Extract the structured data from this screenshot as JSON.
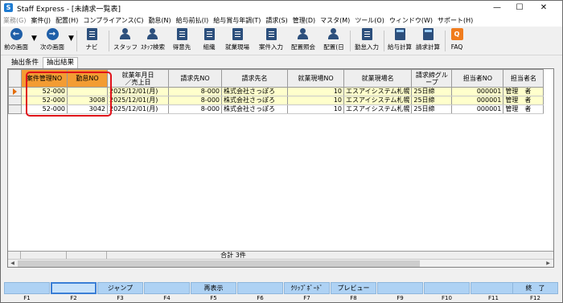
{
  "window": {
    "title": "Staff Express - [未請求一覧表]",
    "app_icon": "S",
    "minimize": "—",
    "maximize": "☐",
    "close": "✕"
  },
  "menu": [
    {
      "label": "業務(G)",
      "disabled": true
    },
    {
      "label": "案件(J)"
    },
    {
      "label": "配置(H)"
    },
    {
      "label": "コンプライアンス(C)"
    },
    {
      "label": "勤怠(N)"
    },
    {
      "label": "給与前払(I)"
    },
    {
      "label": "給与賞与年調(T)"
    },
    {
      "label": "請求(S)"
    },
    {
      "label": "管理(D)"
    },
    {
      "label": "マスタ(M)"
    },
    {
      "label": "ツール(O)"
    },
    {
      "label": "ウィンドウ(W)"
    },
    {
      "label": "サポート(H)"
    }
  ],
  "toolbar": {
    "back": "前の画面",
    "forward": "次の画面",
    "navi": "ナビ",
    "staff": "スタッフ",
    "staff_search": "ｽﾀｯﾌ検索",
    "client": "得意先",
    "org": "組織",
    "site": "就業現場",
    "case_entry": "案件入力",
    "placement_search": "配置照会",
    "placement_day": "配置(日",
    "attendance_entry": "勤怠入力",
    "payroll_calc": "給与計算",
    "billing_calc": "請求計算",
    "faq": "FAQ"
  },
  "tabs": [
    {
      "label": "抽出条件"
    },
    {
      "label": "抽出結果"
    }
  ],
  "grid": {
    "columns": [
      "案件管理NO",
      "勤怠NO",
      "就業年月日\n／売上日",
      "請求先NO",
      "請求先名",
      "就業現場NO",
      "就業現場名",
      "請求締グル\nープ",
      "担当者NO",
      "担当者名"
    ],
    "rows": [
      [
        "52-000",
        "",
        "2025/12/01(月)",
        "8-000",
        "株式会社さっぽろ",
        "10",
        "エスアイシステム札幌",
        "25日締",
        "000001",
        "管理　者"
      ],
      [
        "52-000",
        "3008",
        "2025/12/01(月)",
        "8-000",
        "株式会社さっぽろ",
        "10",
        "エスアイシステム札幌",
        "25日締",
        "000001",
        "管理　者"
      ],
      [
        "52-000",
        "3042",
        "2025/12/01(月)",
        "8-000",
        "株式会社さっぽろ",
        "10",
        "エスアイシステム札幌",
        "25日締",
        "000001",
        "管理　者"
      ]
    ],
    "footer_total": "合計 3件"
  },
  "fkeys": [
    {
      "no": "F1",
      "label": ""
    },
    {
      "no": "F2",
      "label": ""
    },
    {
      "no": "F3",
      "label": "ジャンプ"
    },
    {
      "no": "F4",
      "label": ""
    },
    {
      "no": "F5",
      "label": "再表示"
    },
    {
      "no": "F6",
      "label": ""
    },
    {
      "no": "F7",
      "label": "ｸﾘｯﾌﾟﾎﾞｰﾄﾞ"
    },
    {
      "no": "F8",
      "label": "プレビュー"
    },
    {
      "no": "F9",
      "label": ""
    },
    {
      "no": "F10",
      "label": ""
    },
    {
      "no": "F11",
      "label": ""
    },
    {
      "no": "F12",
      "label": "終　了"
    }
  ],
  "colors": {
    "highlight_header": "#f39c33",
    "highlight_row": "#ffffcc",
    "annotation_box": "#e0121a",
    "fkey": "#aed2f4"
  }
}
